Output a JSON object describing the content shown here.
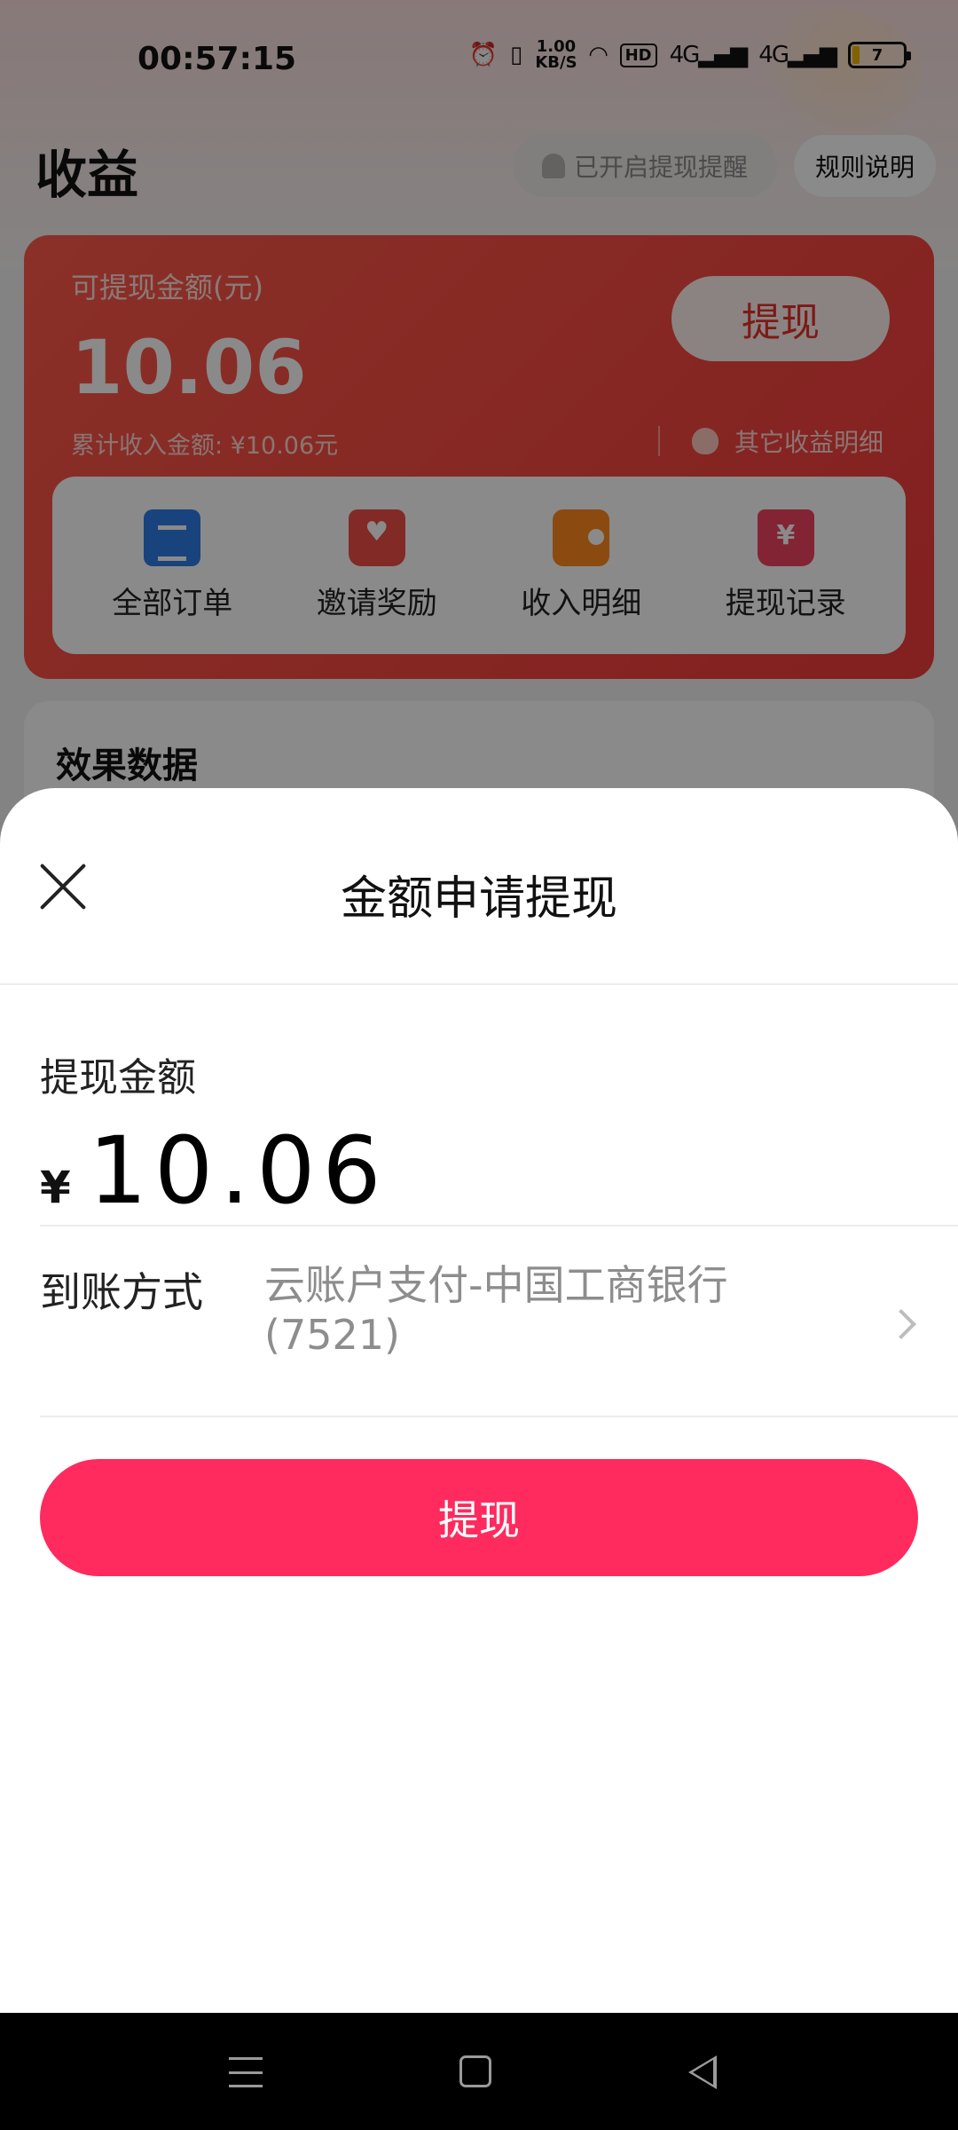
{
  "status_bar": {
    "time": "00:57:15",
    "net_speed_value": "1.00",
    "net_speed_unit": "KB/S",
    "hd_label": "HD",
    "signal1_label": "4G",
    "signal2_label": "4G",
    "battery_level": "7"
  },
  "header": {
    "title": "收益",
    "reminder_label": "已开启提现提醒",
    "rules_label": "规则说明"
  },
  "earnings_card": {
    "withdrawable_label": "可提现金额(元)",
    "withdrawable_amount": "10.06",
    "cumulative_label": "累计收入金额: ¥10.06元",
    "withdraw_button": "提现",
    "other_income_label": "其它收益明细",
    "quick_actions": [
      {
        "label": "全部订单",
        "icon": "clipboard-icon"
      },
      {
        "label": "邀请奖励",
        "icon": "gift-envelope-icon"
      },
      {
        "label": "收入明细",
        "icon": "wallet-icon"
      },
      {
        "label": "提现记录",
        "icon": "yuan-receipt-icon"
      }
    ]
  },
  "effect_section": {
    "title": "效果数据"
  },
  "sheet": {
    "title": "金额申请提现",
    "amount_label": "提现金额",
    "currency_symbol": "¥",
    "amount_value": "10.06",
    "payout_label": "到账方式",
    "payout_value": "云账户支付-中国工商银行(7521)",
    "submit_label": "提现"
  },
  "colors": {
    "primary_button": "#ff2a5e",
    "card_red": "#f23b3b"
  }
}
